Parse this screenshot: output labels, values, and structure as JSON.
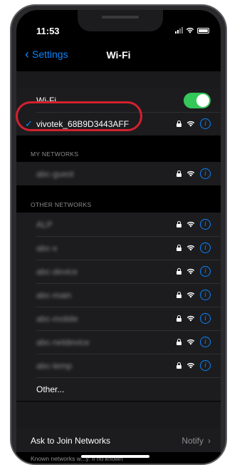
{
  "status_bar": {
    "time": "11:53"
  },
  "nav": {
    "back_label": "Settings",
    "title": "Wi-Fi"
  },
  "wifi_toggle": {
    "label": "Wi-Fi",
    "state": "on"
  },
  "connected": {
    "name": "vivotek_68B9D3443AFF"
  },
  "my_networks": {
    "header": "MY NETWORKS",
    "items": [
      {
        "name": "abc-guest",
        "locked": true
      }
    ]
  },
  "other_networks": {
    "header": "OTHER NETWORKS",
    "items": [
      {
        "name": "ALP",
        "locked": true
      },
      {
        "name": "abc-x",
        "locked": true
      },
      {
        "name": "abc-device",
        "locked": true
      },
      {
        "name": "abc-main",
        "locked": true
      },
      {
        "name": "abc-mobile",
        "locked": true
      },
      {
        "name": "abc-netdevice",
        "locked": true
      },
      {
        "name": "abc-temp",
        "locked": true
      }
    ],
    "other_label": "Other..."
  },
  "ask_to_join": {
    "label": "Ask to Join Networks",
    "value": "Notify"
  },
  "footer_text": "Known networks w...y. If no known",
  "colors": {
    "accent": "#0a84ff",
    "toggle_on": "#34c759",
    "highlight": "#d3202f"
  },
  "icons": {
    "lock": "lock-icon",
    "wifi": "wifi-icon",
    "info": "info-icon",
    "check": "checkmark-icon"
  }
}
